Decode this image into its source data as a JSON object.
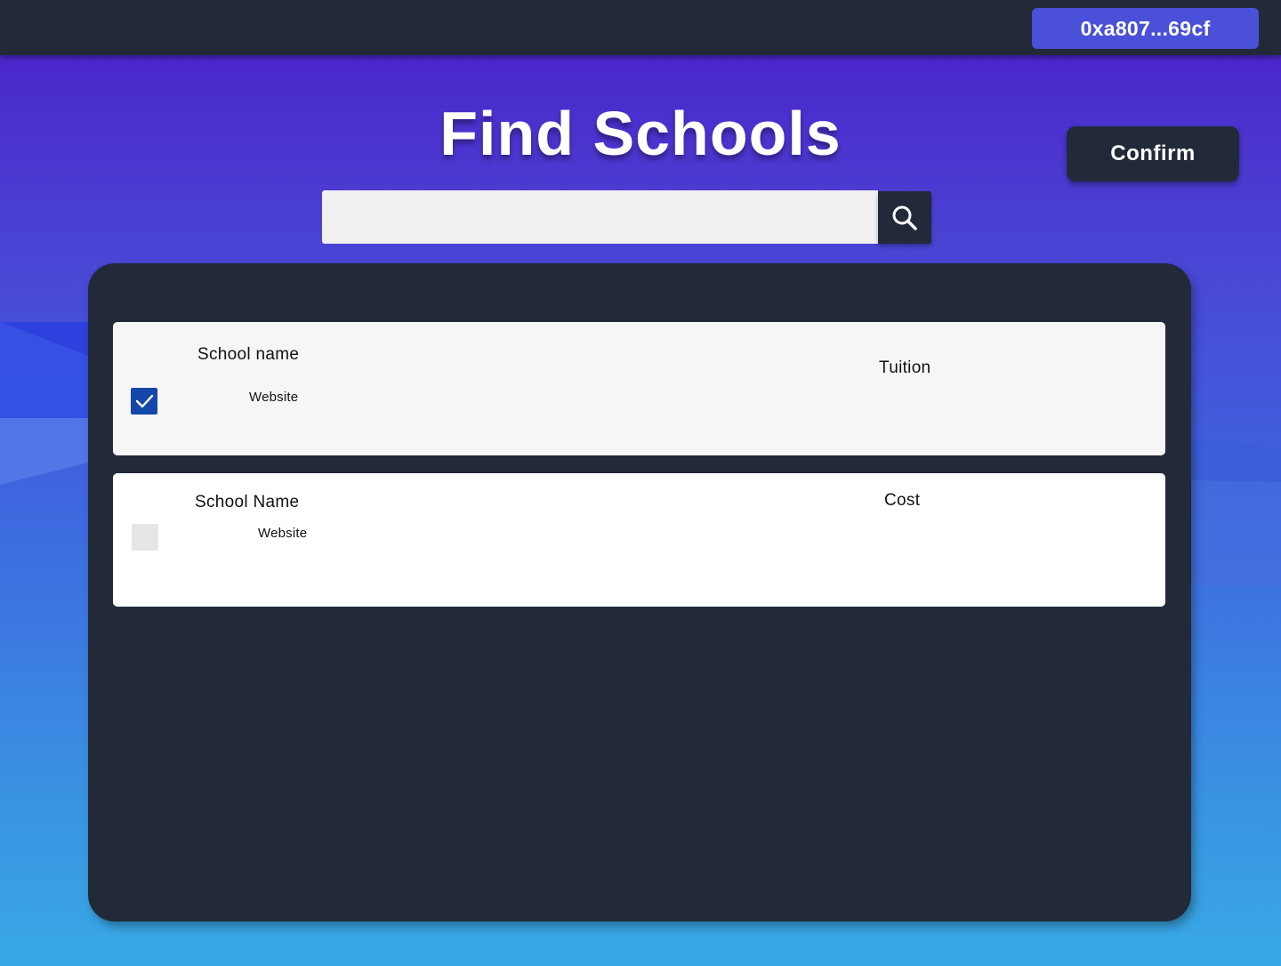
{
  "header": {
    "wallet_address": "0xa807...69cf"
  },
  "main": {
    "title": "Find Schools",
    "confirm_label": "Confirm",
    "search": {
      "value": "",
      "placeholder": ""
    }
  },
  "results": [
    {
      "name": "School name",
      "website": "Website",
      "price_label": "Tuition",
      "selected": true
    },
    {
      "name": "School Name",
      "website": "Website",
      "price_label": "Cost",
      "selected": false
    }
  ],
  "icons": {
    "search": "search-icon",
    "check": "checkmark-icon"
  },
  "colors": {
    "topbar": "#222a3a",
    "wallet_button": "#4a51d8",
    "panel": "#222a3a",
    "checkbox_checked": "#1547a8",
    "checkbox_empty": "#e6e6e6"
  }
}
